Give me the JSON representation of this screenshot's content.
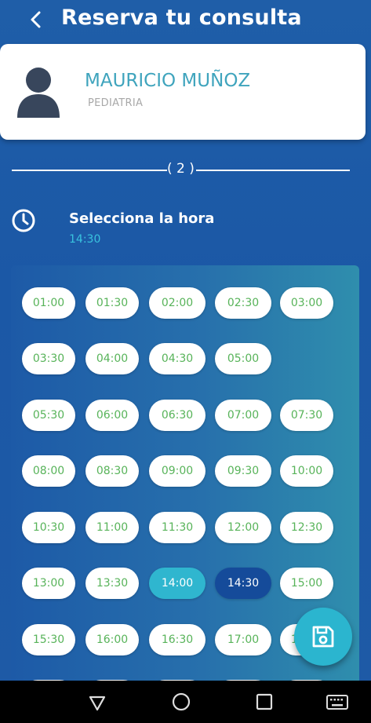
{
  "header": {
    "title": "Reserva tu consulta"
  },
  "doctor": {
    "name": "MAURICIO MUÑOZ",
    "specialty": "PEDIATRIA"
  },
  "step": {
    "label": "( 2 )"
  },
  "selection": {
    "title": "Selecciona la hora",
    "value": "14:30"
  },
  "slots": [
    [
      "01:00",
      "01:30",
      "02:00",
      "02:30",
      "03:00"
    ],
    [
      "03:30",
      "04:00",
      "04:30",
      "05:00"
    ],
    [
      "05:30",
      "06:00",
      "06:30",
      "07:00",
      "07:30"
    ],
    [
      "08:00",
      "08:30",
      "09:00",
      "09:30",
      "10:00"
    ],
    [
      "10:30",
      "11:00",
      "11:30",
      "12:00",
      "12:30"
    ],
    [
      "13:00",
      "13:30",
      "14:00",
      "14:30",
      "15:00"
    ],
    [
      "15:30",
      "16:00",
      "16:30",
      "17:00",
      "17:30"
    ]
  ],
  "highlighted_slot": "14:00",
  "selected_slot": "14:30",
  "colors": {
    "accent": "#2bb5cf",
    "selected": "#154b9a",
    "slot_text": "#57b359",
    "doctor_name": "#3fa4bd"
  },
  "icons": {
    "back": "chevron-left-icon",
    "avatar": "person-icon",
    "clock": "clock-icon",
    "save": "save-disk-icon"
  }
}
